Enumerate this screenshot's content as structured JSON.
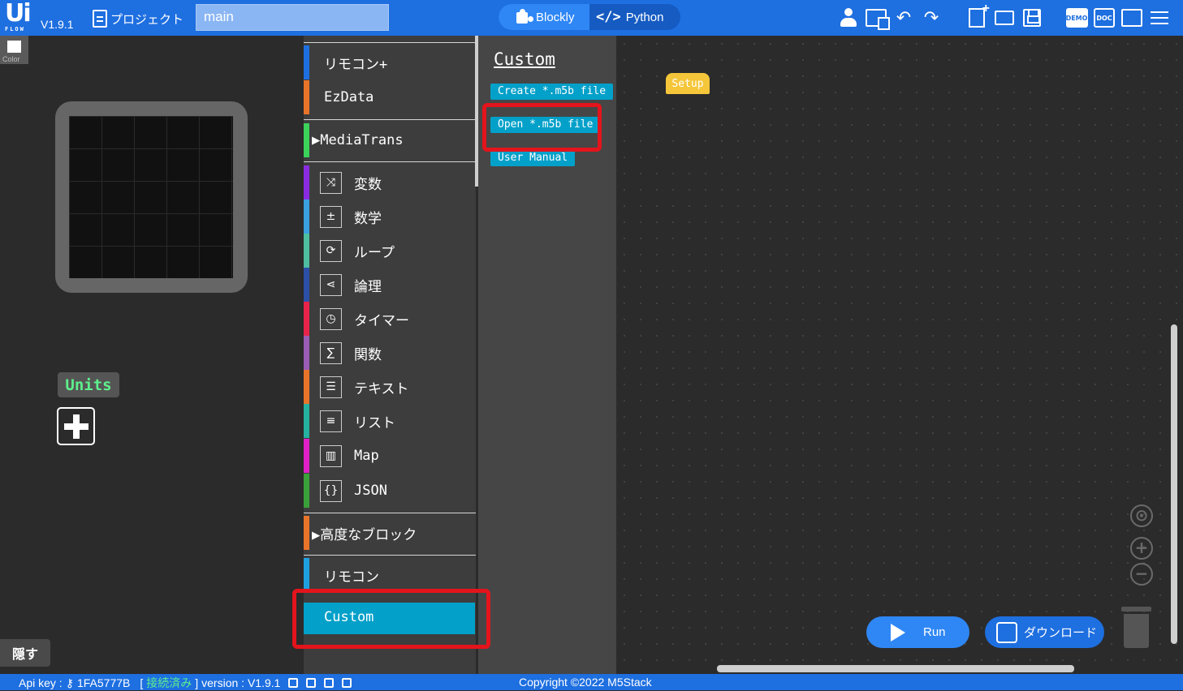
{
  "header": {
    "logo_ui": "Ui",
    "logo_flow": "FLOW",
    "version": "V1.9.1",
    "project_label": "プロジェクト",
    "file_name": "main",
    "mode_blockly": "Blockly",
    "mode_python": "Python",
    "demo_label": "DEMO",
    "doc_label": "DOC"
  },
  "left_panel": {
    "color_label": "Color",
    "units_label": "Units",
    "hide_label": "隠す"
  },
  "toolbox": {
    "categories": [
      {
        "label": "リモコン+",
        "color": "#1e6fe0"
      },
      {
        "label": "EzData",
        "color": "#e8742a"
      },
      {
        "label": "MediaTrans",
        "color": "#3bd35a"
      },
      {
        "label": "変数",
        "color": "#8a2be2"
      },
      {
        "label": "数学",
        "color": "#3aa0e0"
      },
      {
        "label": "ループ",
        "color": "#4dbfa0"
      },
      {
        "label": "論理",
        "color": "#2c4fa8"
      },
      {
        "label": "タイマー",
        "color": "#e8244a"
      },
      {
        "label": "関数",
        "color": "#9a5cb5"
      },
      {
        "label": "テキスト",
        "color": "#e8742a"
      },
      {
        "label": "リスト",
        "color": "#25b0a0"
      },
      {
        "label": "Map",
        "color": "#e020c8"
      },
      {
        "label": "JSON",
        "color": "#3aa03a"
      },
      {
        "label": "高度なブロック",
        "color": "#e8742a"
      },
      {
        "label": "リモコン",
        "color": "#1ea0e0"
      },
      {
        "label": "Custom",
        "color": "#03a0c9"
      }
    ]
  },
  "flyout": {
    "title": "Custom",
    "buttons": [
      "Create *.m5b file",
      "Open *.m5b file",
      "User Manual"
    ]
  },
  "workspace": {
    "setup_block": "Setup",
    "run_label": "Run",
    "download_label": "ダウンロード"
  },
  "status": {
    "api_key_label": "Api key :",
    "api_key": "1FA5777B",
    "bracket_open": "[",
    "connected": "接続済み",
    "bracket_close": "]",
    "version_label": "version : V1.9.1",
    "copyright": "Copyright ©2022 M5Stack"
  },
  "icons": {
    "project": "document-icon",
    "blockly": "puzzle-icon",
    "python": "code-icon",
    "user": "user-icon",
    "device": "device-icon",
    "undo": "undo-icon",
    "redo": "redo-icon",
    "new_file": "new-file-icon",
    "open": "folder-icon",
    "save": "save-icon",
    "menu": "menu-icon"
  },
  "colors": {
    "brand": "#1e6fe0",
    "custom_accent": "#03a0c9",
    "highlight": "#e4141c",
    "setup_block": "#f5c63a",
    "units_text": "#5ef08c"
  }
}
